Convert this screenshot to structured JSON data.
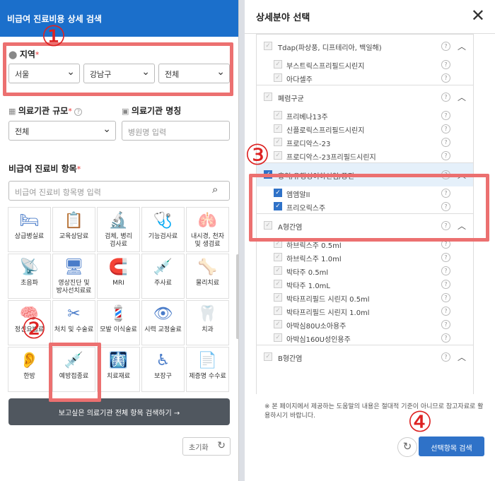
{
  "left": {
    "title": "비급여 진료비용 상세 검색",
    "region": {
      "label": "지역",
      "req": "*",
      "city": "서울",
      "district": "강남구",
      "dong": "전체"
    },
    "scale": {
      "label": "의료기관 규모",
      "req": "*",
      "value": "전체",
      "help": "?"
    },
    "name": {
      "label": "의료기관 명칭",
      "placeholder": "병원명 입력"
    },
    "items": {
      "label": "비급여 진료비 항목",
      "req": "*",
      "placeholder": "비급여 진료비 항목명 입력"
    },
    "cells": [
      {
        "label": "상급병실료",
        "icon": "🛏"
      },
      {
        "label": "교육상담료",
        "icon": "📋"
      },
      {
        "label": "검체, 병리\n검사료",
        "icon": "🔬"
      },
      {
        "label": "기능검사료",
        "icon": "🩺"
      },
      {
        "label": "내시경, 천자\n및 생검료",
        "icon": "🫁"
      },
      {
        "label": "초음파",
        "icon": "📡"
      },
      {
        "label": "영상진단 및\n방사선치료료",
        "icon": "🖥"
      },
      {
        "label": "MRI",
        "icon": "🧲"
      },
      {
        "label": "주사료",
        "icon": "💉"
      },
      {
        "label": "물리치료",
        "icon": "🦴"
      },
      {
        "label": "정신요법료",
        "icon": "🧠"
      },
      {
        "label": "처치 및 수술료",
        "icon": "✂"
      },
      {
        "label": "모발 이식술료",
        "icon": "💈"
      },
      {
        "label": "시력 교정술료",
        "icon": "👁"
      },
      {
        "label": "치과",
        "icon": "🦷"
      },
      {
        "label": "한방",
        "icon": "👂"
      },
      {
        "label": "예방접종료",
        "icon": "💉"
      },
      {
        "label": "치료재료",
        "icon": "🩻"
      },
      {
        "label": "보장구",
        "icon": "♿"
      },
      {
        "label": "제증명 수수료",
        "icon": "📄"
      }
    ],
    "browse": "보고싶은 의료기관 전체 항목 검색하기 →",
    "reset": "초기화"
  },
  "right": {
    "title": "상세분야 선택",
    "close": "✕",
    "list": [
      {
        "t": "g",
        "label": "Tdap(파상풍, 디프테리아, 백일해)",
        "on": false
      },
      {
        "t": "i",
        "label": "부스트릭스프리필드시린지",
        "on": false
      },
      {
        "t": "i",
        "label": "아다셀주",
        "on": false
      },
      {
        "t": "g",
        "label": "폐렴구균",
        "on": false
      },
      {
        "t": "i",
        "label": "프리베나13주",
        "on": false
      },
      {
        "t": "i",
        "label": "신플로릭스프리필드시린지",
        "on": false
      },
      {
        "t": "i",
        "label": "프로디악스-23",
        "on": false
      },
      {
        "t": "i",
        "label": "프로디악스-23프리필드시린지",
        "on": false
      },
      {
        "t": "g",
        "label": "홍역/유행성이하선염/풍진",
        "on": true
      },
      {
        "t": "i",
        "label": "엠엠알II",
        "on": true
      },
      {
        "t": "i",
        "label": "프리오릭스주",
        "on": true
      },
      {
        "t": "g",
        "label": "A형간염",
        "on": false
      },
      {
        "t": "i",
        "label": "하브릭스주 0.5ml",
        "on": false
      },
      {
        "t": "i",
        "label": "하브릭스주 1.0ml",
        "on": false
      },
      {
        "t": "i",
        "label": "박타주 0.5ml",
        "on": false
      },
      {
        "t": "i",
        "label": "박타주 1.0mL",
        "on": false
      },
      {
        "t": "i",
        "label": "박타프리필드 시린지 0.5ml",
        "on": false
      },
      {
        "t": "i",
        "label": "박타프리필드 시린지 1.0ml",
        "on": false
      },
      {
        "t": "i",
        "label": "아박심80U소아용주",
        "on": false
      },
      {
        "t": "i",
        "label": "아박심160U성인용주",
        "on": false
      },
      {
        "t": "g",
        "label": "B형간염",
        "on": false
      }
    ],
    "note": "※ 본 페이지에서 제공하는 도움말의 내용은 절대적 기준이 아니므로 참고자료로 활용하시기 바랍니다.",
    "search": "선택항목 검색"
  },
  "annotations": [
    "①",
    "②",
    "③",
    "④"
  ],
  "colors": {
    "accent": "#2f72c8",
    "header": "#1b6fcb",
    "annotation": "#ec7070"
  }
}
